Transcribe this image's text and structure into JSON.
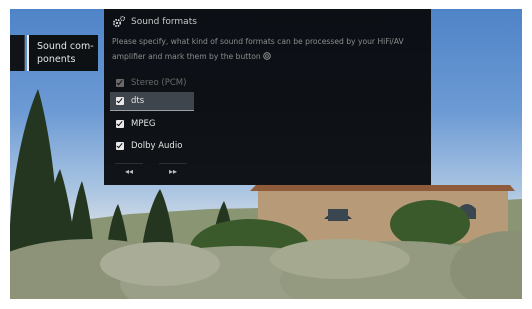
{
  "side_menu": {
    "item_label_line1": "Sound com-",
    "item_label_line2": "ponents"
  },
  "dialog": {
    "title": "Sound formats",
    "description_line1": "Please specify, what kind of sound formats can be processed by your HiFi/AV",
    "description_line2": "amplifier and mark them by the button",
    "options": [
      {
        "label": "Stereo (PCM)",
        "checked": true,
        "enabled": false,
        "selected": false
      },
      {
        "label": "dts",
        "checked": true,
        "enabled": true,
        "selected": true
      },
      {
        "label": "MPEG",
        "checked": true,
        "enabled": true,
        "selected": false
      },
      {
        "label": "Dolby Audio",
        "checked": true,
        "enabled": true,
        "selected": false
      }
    ],
    "nav_back": "◂◂",
    "nav_forward": "▸▸"
  },
  "colors": {
    "dialog_bg": "#08090b",
    "selected_row": "#3f454c",
    "text_primary": "#e4e4e4",
    "text_muted": "#8c8c8c"
  },
  "icons": [
    "gear-icon",
    "ok-button-icon",
    "checkbox-checked-icon",
    "rewind-icon",
    "fast-forward-icon"
  ]
}
